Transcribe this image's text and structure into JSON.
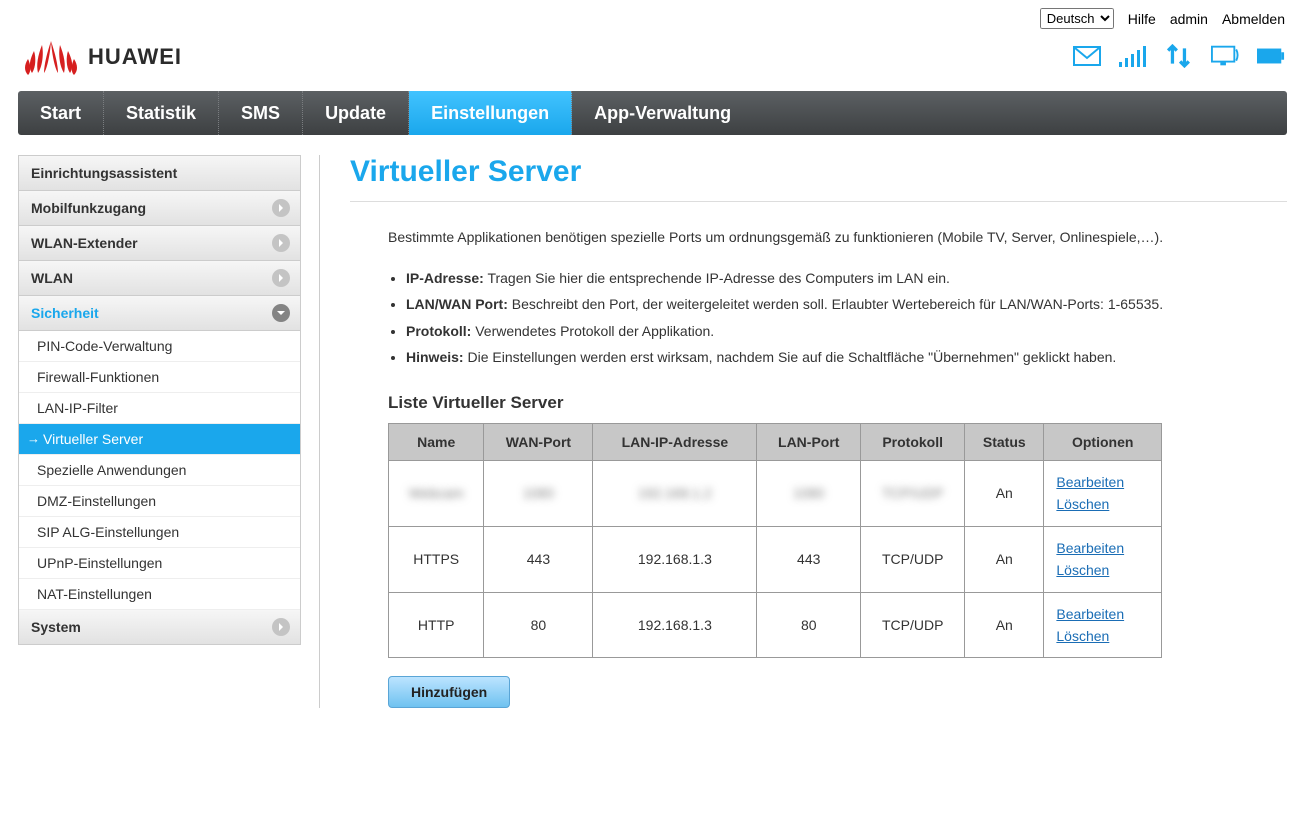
{
  "top": {
    "language": "Deutsch",
    "help": "Hilfe",
    "user": "admin",
    "logout": "Abmelden"
  },
  "brand": "HUAWEI",
  "nav": {
    "items": [
      "Start",
      "Statistik",
      "SMS",
      "Update",
      "Einstellungen",
      "App-Verwaltung"
    ],
    "active_index": 4
  },
  "side": {
    "einrichtung": "Einrichtungsassistent",
    "mobil": "Mobilfunkzugang",
    "wlanext": "WLAN-Extender",
    "wlan": "WLAN",
    "sicherheit": "Sicherheit",
    "sicherheit_sub": [
      "PIN-Code-Verwaltung",
      "Firewall-Funktionen",
      "LAN-IP-Filter",
      "Virtueller Server",
      "Spezielle Anwendungen",
      "DMZ-Einstellungen",
      "SIP ALG-Einstellungen",
      "UPnP-Einstellungen",
      "NAT-Einstellungen"
    ],
    "sicherheit_active": 3,
    "system": "System"
  },
  "page": {
    "title": "Virtueller Server",
    "intro": "Bestimmte Applikationen benötigen spezielle Ports um ordnungsgemäß zu funktionieren (Mobile TV, Server, Onlinespiele,…).",
    "bullets": [
      {
        "b": "IP-Adresse:",
        "t": " Tragen Sie hier die entsprechende IP-Adresse des Computers im LAN ein."
      },
      {
        "b": "LAN/WAN Port:",
        "t": " Beschreibt den Port, der weitergeleitet werden soll. Erlaubter Wertebereich für LAN/WAN-Ports: 1-65535."
      },
      {
        "b": "Protokoll:",
        "t": " Verwendetes Protokoll der Applikation."
      },
      {
        "b": "Hinweis:",
        "t": " Die Einstellungen werden erst wirksam, nachdem Sie auf die Schaltfläche \"Übernehmen\" geklickt haben."
      }
    ],
    "table_title": "Liste Virtueller Server",
    "headers": [
      "Name",
      "WAN-Port",
      "LAN-IP-Adresse",
      "LAN-Port",
      "Protokoll",
      "Status",
      "Optionen"
    ],
    "rows": [
      {
        "name": "Webcam",
        "wan": "1080",
        "ip": "192.168.1.2",
        "lan": "1080",
        "proto": "TCP/UDP",
        "status": "An",
        "blurred": true
      },
      {
        "name": "HTTPS",
        "wan": "443",
        "ip": "192.168.1.3",
        "lan": "443",
        "proto": "TCP/UDP",
        "status": "An",
        "blurred": false
      },
      {
        "name": "HTTP",
        "wan": "80",
        "ip": "192.168.1.3",
        "lan": "80",
        "proto": "TCP/UDP",
        "status": "An",
        "blurred": false
      }
    ],
    "edit": "Bearbeiten",
    "delete": "Löschen",
    "add": "Hinzufügen"
  },
  "colors": {
    "accent": "#1aa7ec"
  }
}
